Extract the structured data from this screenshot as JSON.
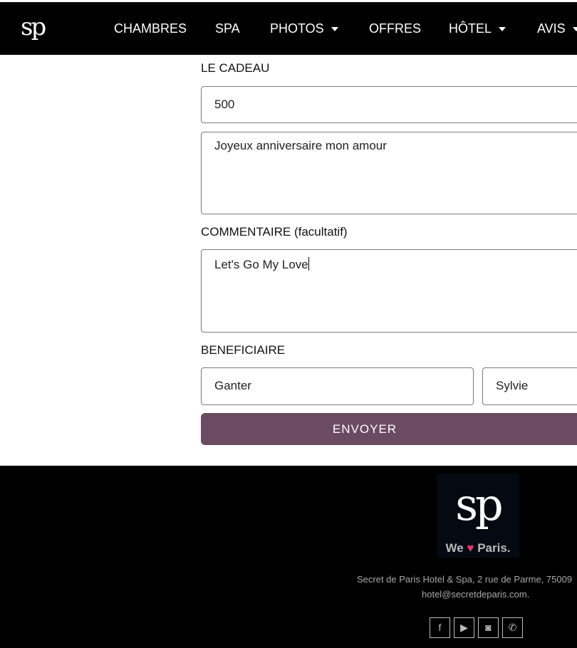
{
  "header": {
    "logo_text": "sp",
    "nav": [
      {
        "label": "CHAMBRES"
      },
      {
        "label": "SPA"
      },
      {
        "label": "PHOTOS"
      },
      {
        "label": "OFFRES"
      },
      {
        "label": "HÔTEL"
      },
      {
        "label": "AVIS"
      }
    ]
  },
  "form": {
    "gift_label": "LE CADEAU",
    "amount_value": "500",
    "message_value": "Joyeux anniversaire mon amour",
    "comment_label": "COMMENTAIRE (facultatif)",
    "comment_value": "Let's Go My Love",
    "beneficiary_label": "BENEFICIAIRE",
    "last_name_value": "Ganter",
    "first_name_value": "Sylvie",
    "submit_label": "ENVOYER"
  },
  "footer": {
    "logo_text": "sp",
    "tagline_we": "We",
    "tagline_heart": "♥",
    "tagline_paris": "Paris.",
    "address": "Secret de Paris Hotel & Spa, 2 rue de Parme, 75009",
    "email": "hotel@secretdeparis.com.",
    "social": [
      {
        "name": "facebook-icon",
        "glyph": "f"
      },
      {
        "name": "youtube-icon",
        "glyph": "▶"
      },
      {
        "name": "instagram-icon",
        "glyph": "◙"
      },
      {
        "name": "whatsapp-icon",
        "glyph": "✆"
      }
    ]
  },
  "colors": {
    "submit_bg": "#6b4b62",
    "heart": "#e8336f"
  }
}
